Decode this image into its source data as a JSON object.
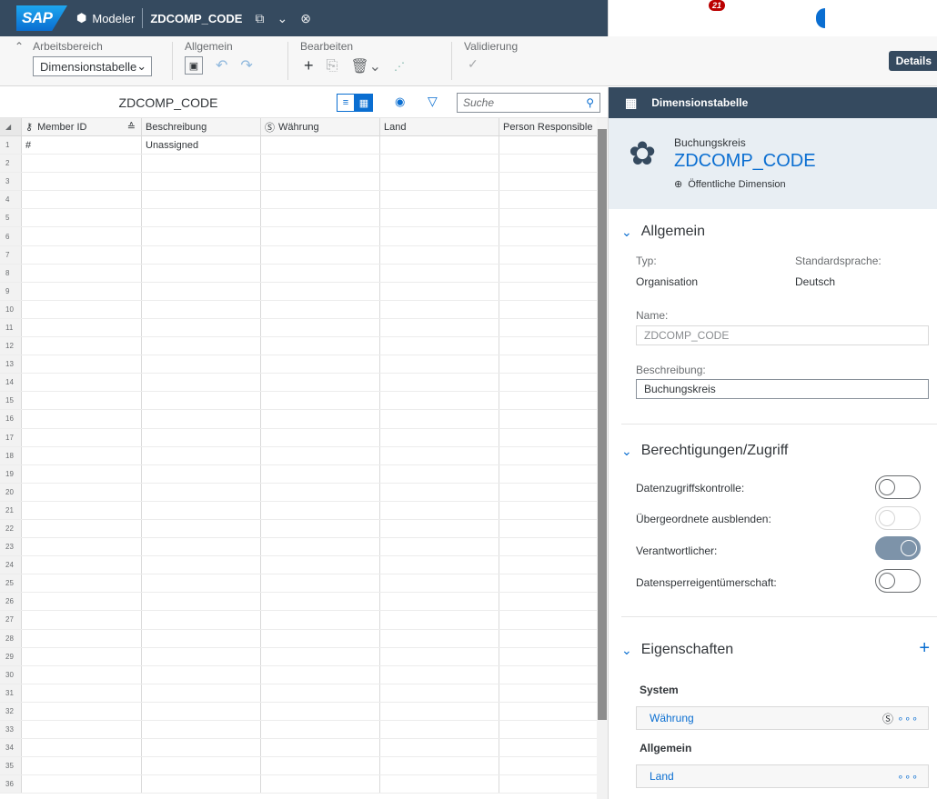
{
  "shell": {
    "logo": "SAP",
    "app_name": "Modeler",
    "model_title": "ZDCOMP_CODE",
    "notification_count": "21"
  },
  "toolbar": {
    "workspace_label": "Arbeitsbereich",
    "workspace_value": "Dimensionstabelle",
    "general_label": "Allgemein",
    "edit_label": "Bearbeiten",
    "validation_label": "Validierung",
    "details_label": "Details"
  },
  "grid": {
    "title": "ZDCOMP_CODE",
    "search_placeholder": "Suche",
    "columns": [
      "Member ID",
      "Beschreibung",
      "Währung",
      "Land",
      "Person Responsible"
    ],
    "rows": [
      {
        "num": "1",
        "member_id": "#",
        "beschreibung": "Unassigned"
      },
      {
        "num": "2"
      },
      {
        "num": "3"
      },
      {
        "num": "4"
      },
      {
        "num": "5"
      },
      {
        "num": "6"
      },
      {
        "num": "7"
      },
      {
        "num": "8"
      },
      {
        "num": "9"
      },
      {
        "num": "10"
      },
      {
        "num": "11"
      },
      {
        "num": "12"
      },
      {
        "num": "13"
      },
      {
        "num": "14"
      },
      {
        "num": "15"
      },
      {
        "num": "16"
      },
      {
        "num": "17"
      },
      {
        "num": "18"
      },
      {
        "num": "19"
      },
      {
        "num": "20"
      },
      {
        "num": "21"
      },
      {
        "num": "22"
      },
      {
        "num": "23"
      },
      {
        "num": "24"
      },
      {
        "num": "25"
      },
      {
        "num": "26"
      },
      {
        "num": "27"
      },
      {
        "num": "28"
      },
      {
        "num": "29"
      },
      {
        "num": "30"
      },
      {
        "num": "31"
      },
      {
        "num": "32"
      },
      {
        "num": "33"
      },
      {
        "num": "34"
      },
      {
        "num": "35"
      },
      {
        "num": "36"
      }
    ]
  },
  "panel": {
    "header_title": "Dimensionstabelle",
    "kind": "Buchungskreis",
    "name": "ZDCOMP_CODE",
    "visibility": "Öffentliche Dimension",
    "general": {
      "title": "Allgemein",
      "type_label": "Typ:",
      "type_value": "Organisation",
      "lang_label": "Standardsprache:",
      "lang_value": "Deutsch",
      "name_label": "Name:",
      "name_value": "ZDCOMP_CODE",
      "desc_label": "Beschreibung:",
      "desc_value": "Buchungskreis"
    },
    "access": {
      "title": "Berechtigungen/Zugriff",
      "data_access": "Datenzugriffskontrolle:",
      "hide_parents": "Übergeordnete ausblenden:",
      "responsible": "Verantwortlicher:",
      "lock_owner": "Datensperreigentümerschaft:"
    },
    "properties": {
      "title": "Eigenschaften",
      "system_group": "System",
      "system_item": "Währung",
      "general_group": "Allgemein",
      "general_item": "Land"
    }
  },
  "colors": {
    "shell": "#354a5f",
    "accent": "#0a6ed1",
    "badge": "#bb0000"
  }
}
